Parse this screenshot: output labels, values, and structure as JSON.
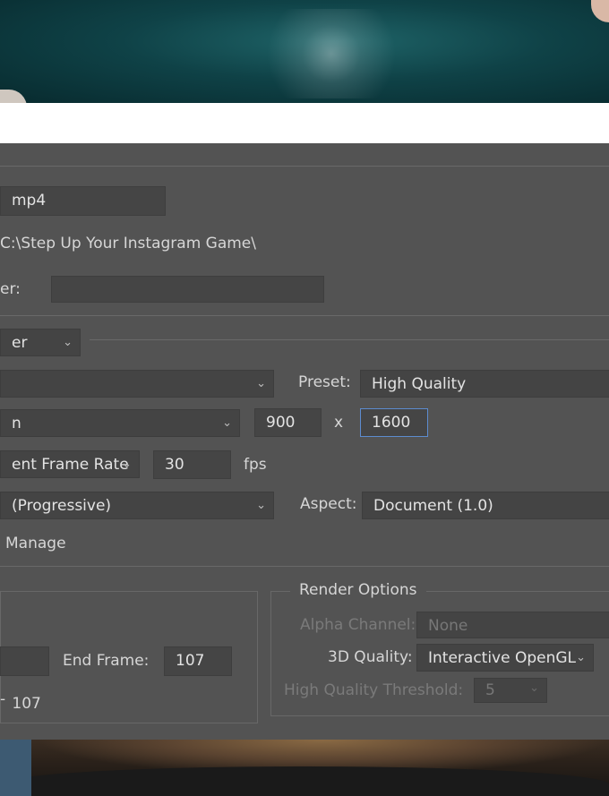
{
  "file": {
    "name_value": "mp4",
    "location": "C:\\Step Up Your Instagram Game\\",
    "subfolder_label": "er:",
    "subfolder_value": ""
  },
  "renderer": {
    "value": "er"
  },
  "format": {
    "value": "",
    "preset_label": "Preset:",
    "preset_value": "High Quality"
  },
  "size": {
    "value": "n",
    "width": "900",
    "separator": "x",
    "height": "1600"
  },
  "frame_rate": {
    "mode": "ent Frame Rate",
    "value": "30",
    "unit": "fps"
  },
  "field_order": {
    "value": "(Progressive)",
    "aspect_label": "Aspect:",
    "aspect_value": "Document (1.0)"
  },
  "color_manage_label": "Manage",
  "range": {
    "end_frame_label": "End Frame:",
    "end_frame_value": "107",
    "summary": "107"
  },
  "render_options": {
    "title": "Render Options",
    "alpha_label": "Alpha Channel:",
    "alpha_value": "None",
    "quality_label": "3D Quality:",
    "quality_value": "Interactive OpenGL",
    "threshold_label": "High Quality Threshold:",
    "threshold_value": "5"
  },
  "icons": {
    "dropdown": "chevron-down-icon"
  },
  "colors": {
    "dialog_bg": "#535353",
    "field_bg": "#454545",
    "focus": "#5d8ccf"
  }
}
